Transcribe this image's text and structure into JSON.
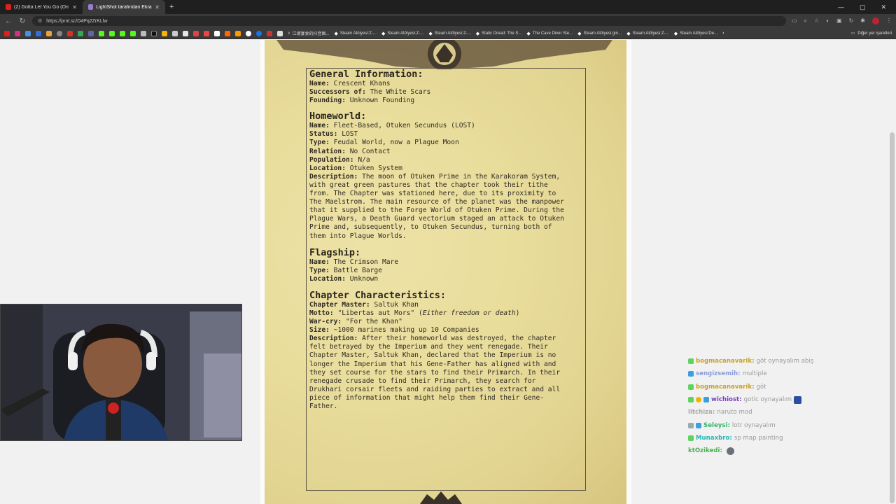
{
  "browser": {
    "tabs": [
      {
        "label": "(2) Gotta Let You Go (Origina",
        "active": false
      },
      {
        "label": "LightShot tarafından Ekran Görünt",
        "active": true
      }
    ],
    "url": "https://prnt.sc/D4Pq2ZrKLlw",
    "bookmarks": [
      "江湖宴食的抖音图...",
      "Steam Atölyesi:Z-...",
      "Steam Atölyesi:Z-...",
      "Steam Atölyesi:Z-...",
      "Static Dread: The S...",
      "The Cave Diver Ste...",
      "Steam Atölyesi:gm...",
      "Steam Atölyesi:Z-...",
      "Steam Atölyesi:De..."
    ],
    "bookmarks_other": "Diğer yer işaretleri"
  },
  "document": {
    "general": {
      "heading": "General Information:",
      "name_k": "Name:",
      "name_v": "Crescent Khans",
      "succ_k": "Successors of:",
      "succ_v": "The White Scars",
      "found_k": "Founding:",
      "found_v": "Unknown Founding"
    },
    "homeworld": {
      "heading": "Homeworld:",
      "name_k": "Name:",
      "name_v": "Fleet-Based, Otuken Secundus (LOST)",
      "status_k": "Status:",
      "status_v": "LOST",
      "type_k": "Type:",
      "type_v": "Feudal World, now a Plague Moon",
      "rel_k": "Relation:",
      "rel_v": "No Contact",
      "pop_k": "Population:",
      "pop_v": "N/a",
      "loc_k": "Location:",
      "loc_v": "Otuken System",
      "desc_k": "Description:",
      "desc_lines": [
        " The moon of Otuken Prime in the Karakoram System,",
        "with great green pastures that the chapter took their tithe",
        "from. The Chapter was stationed here, due to its proximity to",
        "The Maelstrom. The main resource of the planet was the manpower",
        "that it supplied to the Forge World of Otuken Prime. During the",
        "Plague Wars, a Death Guard vectorium staged an attack to Otuken",
        "Prime and, subsequently, to Otuken Secundus, turning both of",
        "them into Plague Worlds."
      ]
    },
    "flagship": {
      "heading": "Flagship:",
      "name_k": "Name:",
      "name_v": "The Crimson Mare",
      "type_k": "Type:",
      "type_v": "Battle Barge",
      "loc_k": "Location:",
      "loc_v": "Unknown"
    },
    "chapter": {
      "heading": "Chapter Characteristics:",
      "master_k": "Chapter Master:",
      "master_v": "Saltuk Khan",
      "motto_k": "Motto:",
      "motto_v": "\"Libertas aut Mors\" (",
      "motto_i": "Either freedom or death",
      "motto_end": ")",
      "war_k": "War-cry:",
      "war_v": "\"For the Khan\"",
      "size_k": "Size:",
      "size_v": "~1000 marines making up 10 Companies",
      "desc_k": "Description:",
      "desc_lines": [
        " After their homeworld was destroyed, the chapter",
        "felt betrayed by the Imperium and they went renegade. Their",
        "Chapter Master, Saltuk Khan, declared that the Imperium is no",
        "longer the Imperium that his Gene-Father has aligned with and",
        "they set course for the stars to find their Primarch. In their",
        "renegade crusade to find their Primarch, they search for",
        "Drukhari corsair fleets and raiding parties to extract and all",
        "piece of information that might help them find their Gene-",
        "Father."
      ]
    }
  },
  "chat": [
    {
      "user": "bogmacanavarik:",
      "msg": "göt oynayalım abiş",
      "color": "#c9a227"
    },
    {
      "user": "sengizsemih:",
      "msg": "multiple",
      "color": "#8a9bd8"
    },
    {
      "user": "bogmacanavarik:",
      "msg": "göt",
      "color": "#c9a227"
    },
    {
      "user": "wichiost:",
      "msg": "gotic oynayalım",
      "color": "#7b3fbf"
    },
    {
      "user": "litchiza:",
      "msg": "naruto mod",
      "color": "#aaaaaa"
    },
    {
      "user": "Seleysi:",
      "msg": "lotr oynayalım",
      "color": "#3cb371"
    },
    {
      "user": "Munaxbro:",
      "msg": "sp map painting",
      "color": "#2bb5b5"
    },
    {
      "user": "ktOzikedi:",
      "msg": "",
      "color": "#4caf50"
    }
  ]
}
